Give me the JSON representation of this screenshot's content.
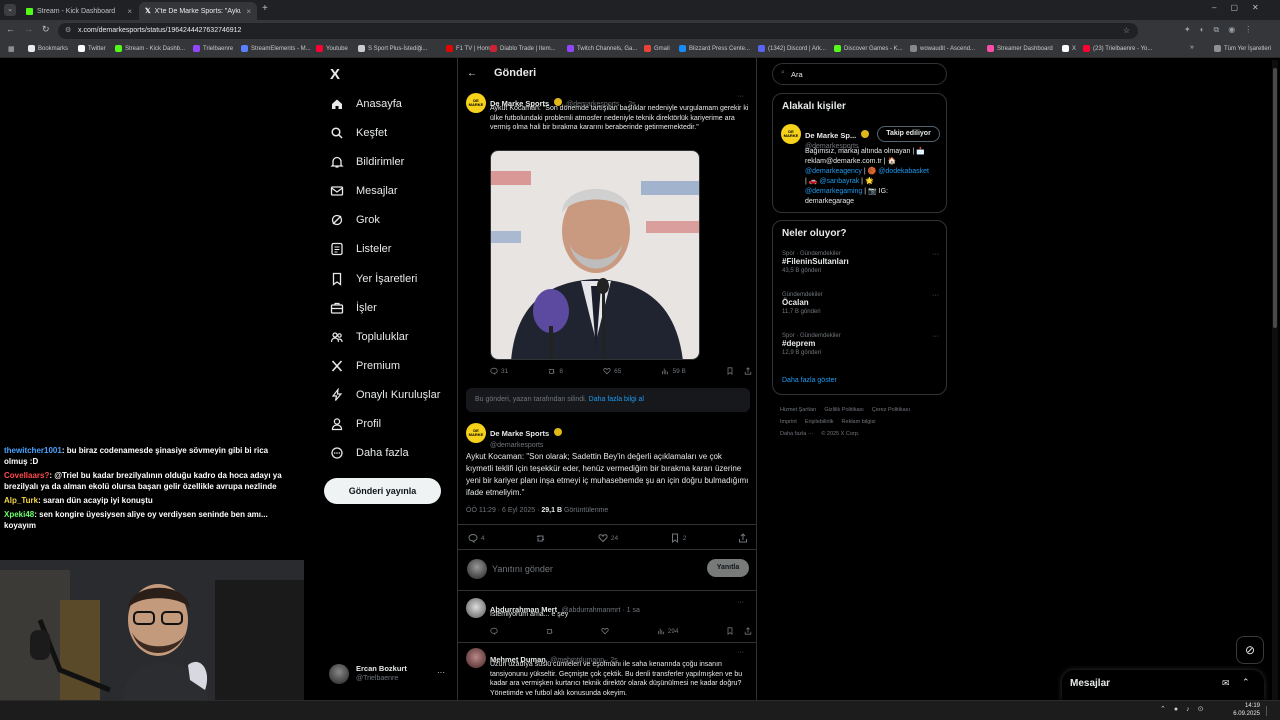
{
  "browser": {
    "tabs": [
      {
        "label": "Stream - Kick Dashboard",
        "active": false
      },
      {
        "label": "X'te De Marke Sports: \"Aykut K",
        "active": true
      }
    ],
    "url": "x.com/demarkesports/status/1964244427632746912",
    "bookmarks": [
      "Bookmarks",
      "Twitter",
      "Stream - Kick Dashb...",
      "Trielbaenre",
      "StreamElements - M...",
      "Youtube",
      "S Sport Plus-İstediği...",
      "F1 TV | Home",
      "Diablo Trade | Item...",
      "Twitch Channels, Ga...",
      "Gmail",
      "Blizzard Press Cente...",
      "(1342) Discord | Ark...",
      "Discover Games - K...",
      "wowaudit - Ascend...",
      "Streamer Dashboard",
      "X",
      "(23) Trielbaenre - Yo..."
    ],
    "all_bookmarks": "Tüm Yer İşaretleri",
    "colors": {
      "chrome_dark": "#202124",
      "chrome": "#35363a"
    }
  },
  "chat": [
    {
      "user": "thewitcher1001",
      "color": "#4aa3ff",
      "text": ": bu biraz codenamesde şinasiye sövmeyin gibi bi rica olmuş :D"
    },
    {
      "user": "Covellaars?",
      "color": "#ff4b4b",
      "text": ": @Triel bu kadar brezilyalının olduğu kadro da hoca adayı ya brezilyalı ya da alman ekolü olursa başarı gelir özellikle avrupa nezlinde"
    },
    {
      "user": "Alp_Turk",
      "color": "#f5d547",
      "text": ": saran dün acayip iyi konuştu"
    },
    {
      "user": "Xpeki48",
      "color": "#6dff6d",
      "text": ": sen kongire üyesiysen aliye oy verdiysen seninde ben amı... koyayım"
    }
  ],
  "nav": {
    "logo": "X",
    "items": [
      "Anasayfa",
      "Keşfet",
      "Bildirimler",
      "Mesajlar",
      "Grok",
      "Listeler",
      "Yer İşaretleri",
      "İşler",
      "Topluluklar",
      "Premium",
      "Onaylı Kuruluşlar",
      "Profil",
      "Daha fazla"
    ],
    "post_button": "Gönderi yayınla",
    "account": {
      "name": "Ercan Bozkurt",
      "handle": "@Trielbaenre",
      "more": "···"
    }
  },
  "main": {
    "header": "Gönderi",
    "quoted_tweet": {
      "author": "De Marke Sports",
      "handle": "@demarkesports",
      "time": "· 2s",
      "text": "Aykut Kocaman: \"Son dönemde tartışılan başlıklar nedeniyle vurgulamam gerekir ki ülke futbolundaki problemli atmosfer nedeniyle teknik direktörlük kariyerime ara vermiş olma hali bir bırakma kararını beraberinde getirmemektedir.\"",
      "replies": "31",
      "reposts": "8",
      "likes": "65",
      "views": "59 B"
    },
    "deleted_notice": "Bu gönderi, yazarı tarafından silindi.",
    "deleted_link": "Daha fazla bilgi al",
    "tweet": {
      "author": "De Marke Sports",
      "handle": "@demarkesports",
      "text": "Aykut Kocaman: \"Son olarak; Sadettin Bey'in değerli açıklamaları ve çok kıymetli teklifi için teşekkür eder, henüz vermediğim bir bırakma kararı üzerine yeni bir kariyer planı inşa etmeyi iç muhasebemde şu an için doğru bulmadığımı ifade etmeliyim.\"",
      "time": "ÖÖ 11:29 · 6 Eyl 2025 ·",
      "views_count": "29,1 B",
      "views_label": "Görüntülenme",
      "replies": "4",
      "likes": "24",
      "bookmarks": "2"
    },
    "reply_placeholder": "Yanıtını gönder",
    "reply_button": "Yanıtla",
    "replies": [
      {
        "author": "Abdurrahman Mert",
        "handle": "@abdurrahmanmrt · 1 sa",
        "text": "İstemiyorum ama... e şey",
        "views": "294"
      },
      {
        "author": "Mehmet Duman",
        "handle": "@mehmtdumann · 2s",
        "text": "Uzun uzadıya süslü cümleleri ve eşofmanı ile saha kenarında çoğu insanın tansiyonunu yükseltir. Geçmişte çok çektik. Bu denli transferler yapılmışken ve bu kadar ara vermişken kurtarıcı teknik direktör olarak düşünülmesi ne kadar doğru? Yönetimde ve futbol aklı konusunda okeyim."
      }
    ]
  },
  "right": {
    "search_placeholder": "Ara",
    "people_title": "Alakalı kişiler",
    "person": {
      "name": "De Marke Sp...",
      "handle": "@demarkesports",
      "follow": "Takip ediliyor",
      "bio1": "Bağımsız, markaj altında olmayan | 📩",
      "bio2": "reklam@demarke.com.tr | 🏠",
      "bio3a": "@demarkeagency",
      "bio3b": " | 🏀 ",
      "bio3c": "@dodekabasket",
      "bio4a": " | 🚗 ",
      "bio4b": "@sarıbayrak",
      "bio4c": " | 🌟",
      "bio5a": "@demarkegaming",
      "bio5b": " | 📷 IG:",
      "bio6": "demarkegarage"
    },
    "trends_title": "Neler oluyor?",
    "trends": [
      {
        "category": "Spor · Gündemdekiler",
        "name": "#FileninSultanları",
        "count": "43,5 B gönderi"
      },
      {
        "category": "Gündemdekiler",
        "name": "Öcalan",
        "count": "11,7 B gönderi"
      },
      {
        "category": "Spor · Gündemdekiler",
        "name": "#deprem",
        "count": "12,9 B gönderi"
      }
    ],
    "show_more": "Daha fazla göster",
    "footer": [
      "Hizmet Şartları",
      "Gizlilik Politikası",
      "Çerez Politikası",
      "Imprint",
      "Erişilebilirlik",
      "Reklam bilgisi",
      "Daha fazla ···",
      "© 2025 X Corp."
    ]
  },
  "messages_drawer": "Mesajlar",
  "taskbar": {
    "time": "14:19",
    "date": "6.09.2025"
  },
  "colors": {
    "accent": "#1d9bf0",
    "verified": "#e2b719",
    "logo_yellow": "#f7d21a"
  }
}
